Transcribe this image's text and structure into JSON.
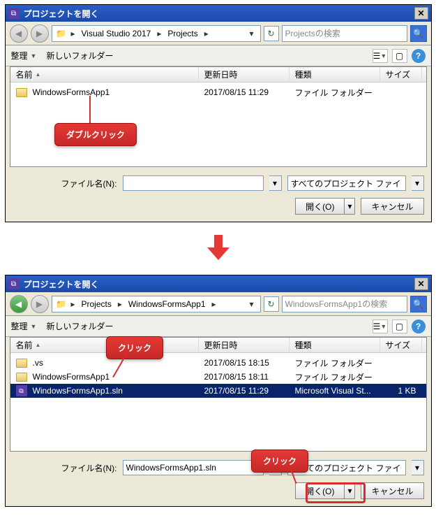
{
  "dialog1": {
    "title": "プロジェクトを開く",
    "breadcrumb": [
      "Visual Studio 2017",
      "Projects"
    ],
    "search_placeholder": "Projectsの検索",
    "toolbar": {
      "organize": "整理",
      "new_folder": "新しいフォルダー"
    },
    "columns": {
      "name": "名前",
      "date": "更新日時",
      "type": "種類",
      "size": "サイズ"
    },
    "rows": [
      {
        "name": "WindowsFormsApp1",
        "date": "2017/08/15 11:29",
        "type": "ファイル フォルダー",
        "size": "",
        "kind": "folder"
      }
    ],
    "filename_label": "ファイル名(N):",
    "filename_value": "",
    "filter": "すべてのプロジェクト ファイ",
    "open_btn": "開く(O)",
    "cancel_btn": "キャンセル",
    "callout": "ダブルクリック"
  },
  "dialog2": {
    "title": "プロジェクトを開く",
    "breadcrumb": [
      "Projects",
      "WindowsFormsApp1"
    ],
    "search_placeholder": "WindowsFormsApp1の検索",
    "toolbar": {
      "organize": "整理",
      "new_folder": "新しいフォルダー"
    },
    "columns": {
      "name": "名前",
      "date": "更新日時",
      "type": "種類",
      "size": "サイズ"
    },
    "rows": [
      {
        "name": ".vs",
        "date": "2017/08/15 18:15",
        "type": "ファイル フォルダー",
        "size": "",
        "kind": "folder"
      },
      {
        "name": "WindowsFormsApp1",
        "date": "2017/08/15 18:11",
        "type": "ファイル フォルダー",
        "size": "",
        "kind": "folder"
      },
      {
        "name": "WindowsFormsApp1.sln",
        "date": "2017/08/15 11:29",
        "type": "Microsoft Visual St...",
        "size": "1 KB",
        "kind": "sln",
        "selected": true
      }
    ],
    "filename_label": "ファイル名(N):",
    "filename_value": "WindowsFormsApp1.sln",
    "filter": "すべてのプロジェクト ファイ",
    "open_btn": "開く(O)",
    "cancel_btn": "キャンセル",
    "callout1": "クリック",
    "callout2": "クリック"
  }
}
